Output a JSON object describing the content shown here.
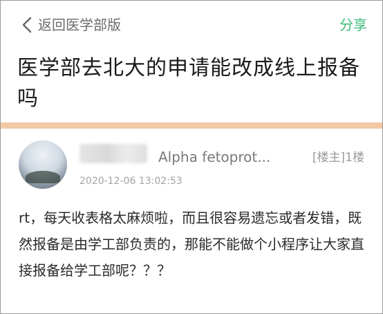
{
  "header": {
    "back_label": "返回医学部版",
    "share_label": "分享",
    "back_icon": "chevron-left-icon"
  },
  "post": {
    "title": "医学部去北大的申请能改成线上报备吗",
    "author_name": "Alpha fetoprot...",
    "floor_tag": "[楼主]1楼",
    "timestamp": "2020-12-06 13:02:53",
    "content": "rt，每天收表格太麻烦啦，而且很容易遗忘或者发错，既然报备是由学工部负责的，那能不能做个小程序让大家直接报备给学工部呢？？？"
  },
  "colors": {
    "accent": "#3dbb7a",
    "divider": "#f3c8a4"
  }
}
